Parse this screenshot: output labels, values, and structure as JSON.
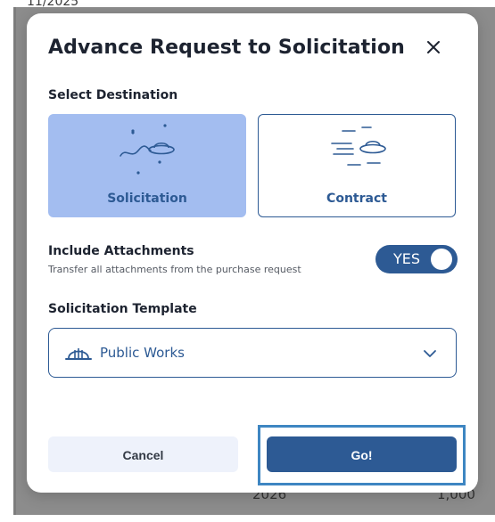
{
  "background": {
    "top_text": "11/2025",
    "bottom_year": "2026",
    "bottom_value": "1,000"
  },
  "modal": {
    "title": "Advance Request to Solicitation",
    "destination": {
      "label": "Select Destination",
      "options": [
        {
          "label": "Solicitation",
          "selected": true,
          "icon": "ufo-stars-icon"
        },
        {
          "label": "Contract",
          "selected": false,
          "icon": "ufo-speed-lines-icon"
        }
      ]
    },
    "attachments": {
      "title": "Include Attachments",
      "subtitle": "Transfer all attachments from the purchase request",
      "toggle_label": "YES",
      "enabled": true
    },
    "template": {
      "label": "Solicitation Template",
      "value": "Public Works",
      "icon": "hard-hat-icon"
    },
    "buttons": {
      "cancel": "Cancel",
      "go": "Go!"
    }
  },
  "colors": {
    "primary": "#2d5a94",
    "selected_card": "#a3bdf0",
    "highlight": "#3e86c2"
  }
}
